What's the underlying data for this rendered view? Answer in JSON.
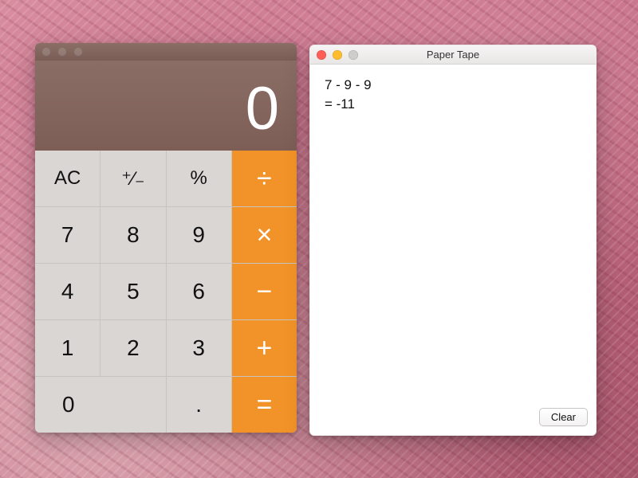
{
  "calculator": {
    "display": "0",
    "keys": {
      "ac": "AC",
      "sign": "⁺∕₋",
      "percent": "%",
      "divide": "÷",
      "seven": "7",
      "eight": "8",
      "nine": "9",
      "multiply": "×",
      "four": "4",
      "five": "5",
      "six": "6",
      "minus": "−",
      "one": "1",
      "two": "2",
      "three": "3",
      "plus": "+",
      "zero": "0",
      "decimal": ".",
      "equals": "="
    }
  },
  "paper_tape": {
    "title": "Paper Tape",
    "lines": [
      "7 - 9 - 9",
      "= -11"
    ],
    "clear_label": "Clear"
  }
}
